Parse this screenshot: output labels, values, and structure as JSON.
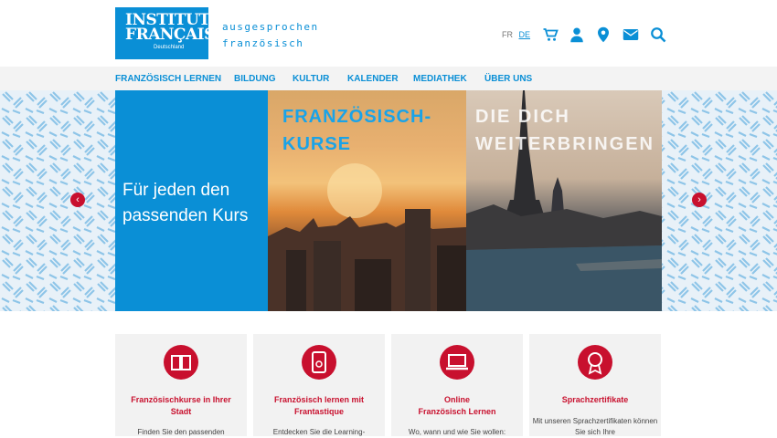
{
  "header": {
    "logo": {
      "line1": "INSTITUT",
      "line2": "FRANÇAIS",
      "line3": "Deutschland"
    },
    "tagline": [
      "ausgesprochen",
      "französisch"
    ],
    "lang": {
      "fr": "FR",
      "de": "DE"
    },
    "icons": [
      "cart-icon",
      "user-icon",
      "location-icon",
      "mail-icon",
      "search-icon"
    ]
  },
  "nav": {
    "items": [
      "FRANZÖSISCH LERNEN",
      "BILDUNG",
      "KULTUR",
      "KALENDER",
      "MEDIATHEK",
      "ÜBER UNS"
    ]
  },
  "hero": {
    "left_text": [
      "Für jeden den",
      "passenden Kurs"
    ],
    "middle_text": [
      "FRANZÖSISCH-",
      "KURSE"
    ],
    "right_text": [
      "DIE DICH",
      "WEITERBRINGEN"
    ],
    "prev": "‹",
    "next": "›"
  },
  "cards": [
    {
      "icon": "book-icon",
      "title": [
        "Französischkurse in Ihrer",
        "Stadt"
      ],
      "desc": "Finden Sie den passenden"
    },
    {
      "icon": "tablet-icon",
      "title": [
        "Französisch lernen mit",
        "Frantastique"
      ],
      "desc": "Entdecken Sie die Learning-"
    },
    {
      "icon": "laptop-icon",
      "title": [
        "Online",
        "Französisch Lernen"
      ],
      "desc": "Wo, wann und wie Sie wollen:"
    },
    {
      "icon": "certificate-icon",
      "title": [
        "Sprachzertifikate"
      ],
      "desc": "Mit unseren Sprachzertifikaten können Sie sich Ihre"
    }
  ],
  "colors": {
    "brand_blue": "#0a8fd6",
    "accent_red": "#c8102e",
    "nav_bg": "#f3f3f3"
  }
}
